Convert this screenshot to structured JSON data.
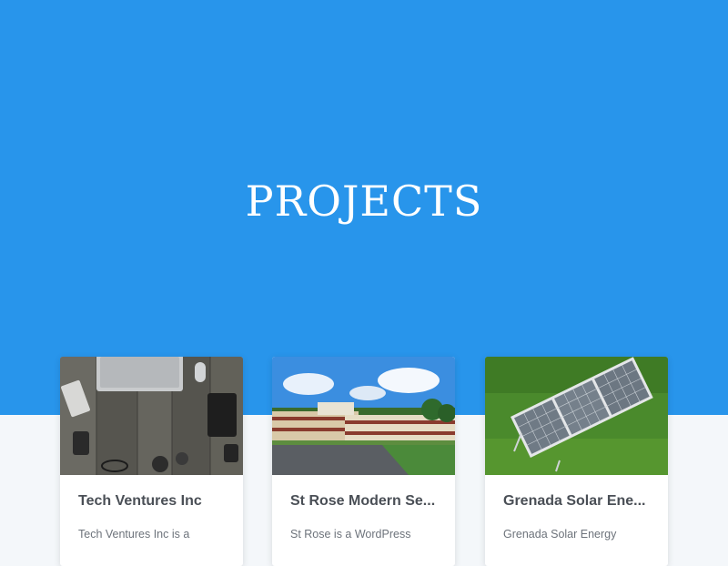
{
  "hero": {
    "title": "PROJECTS",
    "background": "#2895eb"
  },
  "projects": [
    {
      "title": "Tech Ventures Inc",
      "excerpt": "Tech Ventures Inc is a",
      "image": "wooden-desk-with-laptop-photo"
    },
    {
      "title": "St Rose Modern Se...",
      "excerpt": "St Rose is a WordPress",
      "image": "school-building-photo"
    },
    {
      "title": "Grenada Solar Ene...",
      "excerpt": "Grenada Solar Energy",
      "image": "solar-panel-on-grass-photo"
    }
  ]
}
